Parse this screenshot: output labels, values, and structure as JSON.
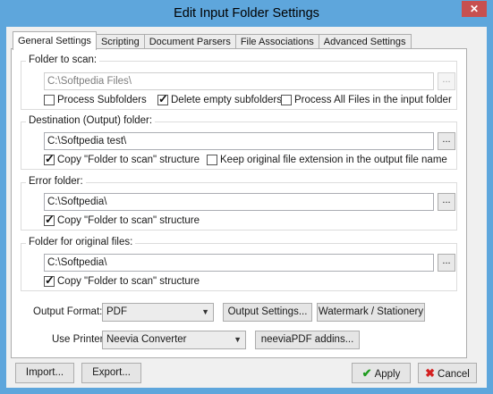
{
  "window": {
    "title": "Edit Input Folder Settings",
    "close_glyph": "✕"
  },
  "tabs": [
    {
      "label": "General Settings",
      "active": true
    },
    {
      "label": "Scripting"
    },
    {
      "label": "Document Parsers"
    },
    {
      "label": "File Associations"
    },
    {
      "label": "Advanced Settings"
    }
  ],
  "folder_to_scan": {
    "label": "Folder to scan:",
    "value": "C:\\Softpedia Files\\",
    "browse": "...",
    "process_subfolders": {
      "label": "Process Subfolders",
      "checked": false
    },
    "delete_empty": {
      "label": "Delete empty subfolders",
      "checked": true
    },
    "process_all": {
      "label": "Process All Files in the input folder",
      "checked": false
    }
  },
  "destination": {
    "label": "Destination (Output) folder:",
    "value": "C:\\Softpedia test\\",
    "browse": "...",
    "copy_structure": {
      "label": "Copy \"Folder to scan\" structure",
      "checked": true
    },
    "keep_extension": {
      "label": "Keep original file extension in the output file name",
      "checked": false
    }
  },
  "error_folder": {
    "label": "Error folder:",
    "value": "C:\\Softpedia\\",
    "browse": "...",
    "copy_structure": {
      "label": "Copy \"Folder to scan\" structure",
      "checked": true
    }
  },
  "original_files": {
    "label": "Folder for original files:",
    "value": "C:\\Softpedia\\",
    "browse": "...",
    "copy_structure": {
      "label": "Copy \"Folder to scan\" structure",
      "checked": true
    }
  },
  "output_format": {
    "label": "Output Format:",
    "value": "PDF",
    "output_settings_button": "Output Settings...",
    "watermark_button": "Watermark / Stationery"
  },
  "printer": {
    "label": "Use Printer:",
    "value": "Neevia Converter",
    "addins_button": "neeviaPDF addins..."
  },
  "footer": {
    "import_button": "Import...",
    "export_button": "Export...",
    "apply_button": "Apply",
    "cancel_button": "Cancel",
    "apply_icon": "checkmark-icon",
    "cancel_icon": "x-icon"
  }
}
